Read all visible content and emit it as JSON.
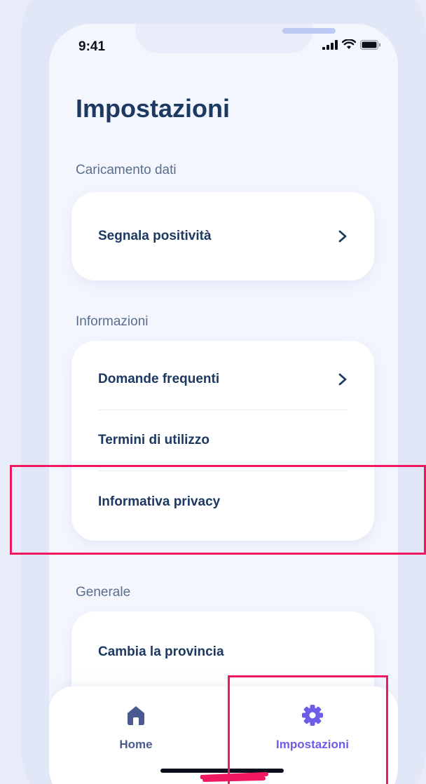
{
  "status_bar": {
    "time": "9:41"
  },
  "page": {
    "title": "Impostazioni"
  },
  "sections": [
    {
      "label": "Caricamento dati",
      "items": [
        {
          "label": "Segnala positività",
          "chevron": true
        }
      ]
    },
    {
      "label": "Informazioni",
      "items": [
        {
          "label": "Domande frequenti",
          "chevron": true
        },
        {
          "label": "Termini di utilizzo",
          "chevron": false
        },
        {
          "label": "Informativa privacy",
          "chevron": false
        }
      ]
    },
    {
      "label": "Generale",
      "items": [
        {
          "label": "Cambia la provincia",
          "chevron": false
        }
      ]
    }
  ],
  "tabbar": {
    "tabs": [
      {
        "label": "Home",
        "icon": "home-icon",
        "active": false
      },
      {
        "label": "Impostazioni",
        "icon": "gear-icon",
        "active": true
      }
    ]
  },
  "colors": {
    "title": "#1d3961",
    "section_label": "#5a6e8c",
    "active_tab": "#6c5ce7",
    "inactive_tab": "#4a5a90",
    "highlight": "#f0195f"
  }
}
